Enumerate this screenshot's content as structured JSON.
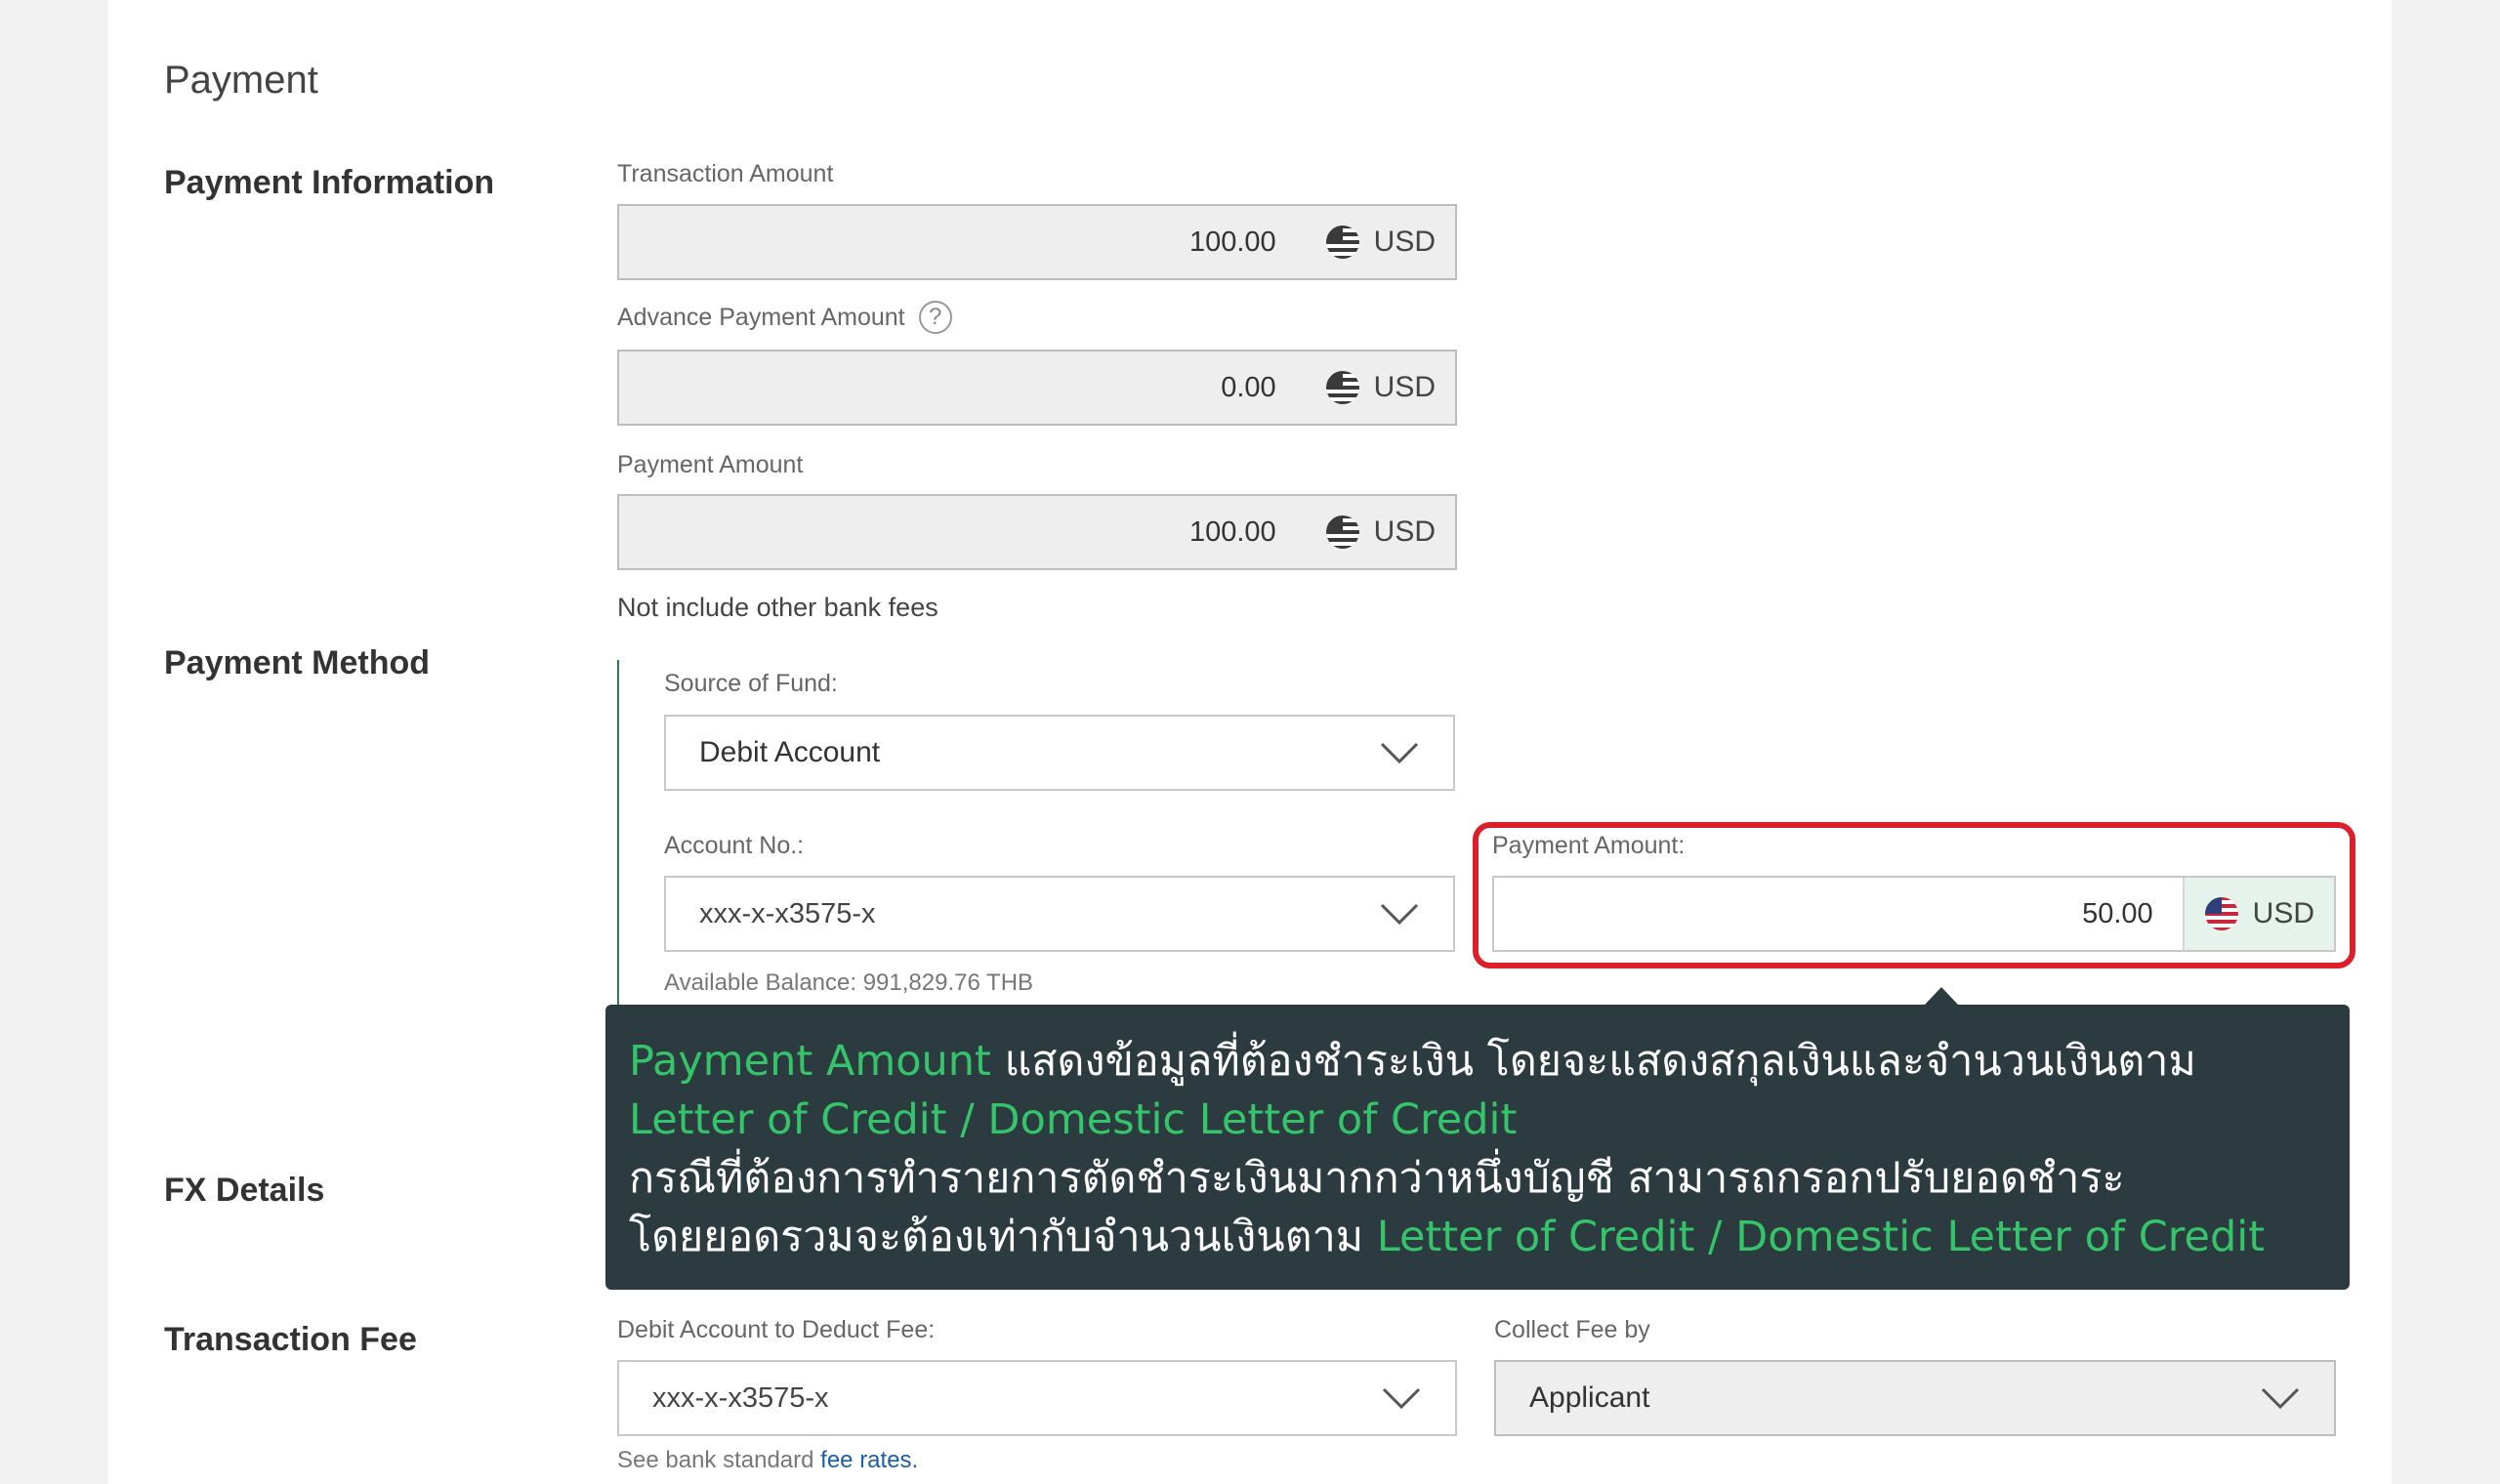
{
  "page": {
    "title": "Payment"
  },
  "payment_information": {
    "section_title": "Payment Information",
    "transaction_amount": {
      "label": "Transaction Amount",
      "value": "100.00",
      "currency": "USD"
    },
    "advance_payment_amount": {
      "label": "Advance Payment Amount",
      "help_glyph": "?",
      "value": "0.00",
      "currency": "USD"
    },
    "payment_amount": {
      "label": "Payment Amount",
      "value": "100.00",
      "currency": "USD"
    },
    "note": "Not include other bank fees"
  },
  "payment_method": {
    "section_title": "Payment Method",
    "source_of_fund": {
      "label": "Source of Fund:",
      "value": "Debit Account"
    },
    "account_no": {
      "label": "Account No.:",
      "value": "xxx-x-x3575-x"
    },
    "available_balance": "Available Balance: 991,829.76 THB",
    "payment_amount": {
      "label": "Payment Amount:",
      "value": "50.00",
      "currency": "USD"
    }
  },
  "tooltip": {
    "line1_highlight": "Payment Amount",
    "line1_text": " แสดงข้อมูลที่ต้องชำระเงิน โดยจะแสดงสกุลเงินและจำนวนเงินตาม",
    "line2_highlight": "Letter of Credit / Domestic Letter of Credit",
    "line3_text": "กรณีที่ต้องการทำรายการตัดชำระเงินมากกว่าหนึ่งบัญชี สามารถกรอกปรับยอดชำระ",
    "line4_text": "โดยยอดรวมจะต้องเท่ากับจำนวนเงินตาม ",
    "line4_highlight": "Letter of Credit / Domestic Letter of Credit"
  },
  "fx_details": {
    "section_title": "FX Details"
  },
  "transaction_fee": {
    "section_title": "Transaction Fee",
    "debit_account": {
      "label": "Debit Account to Deduct Fee:",
      "value": "xxx-x-x3575-x"
    },
    "collect_fee_by": {
      "label": "Collect Fee by",
      "value": "Applicant"
    },
    "fee_note_prefix": "See bank standard ",
    "fee_note_link": "fee rates."
  },
  "icons": {
    "currency_flag": "us-flag-icon",
    "dropdown": "chevron-down-icon",
    "help": "help-circle-icon"
  },
  "colors": {
    "highlight_border": "#dc1f2b",
    "tooltip_bg": "#2c3b40",
    "tooltip_accent": "#35c46a",
    "method_rule": "#2e7d4f",
    "link": "#1a5fa8"
  }
}
